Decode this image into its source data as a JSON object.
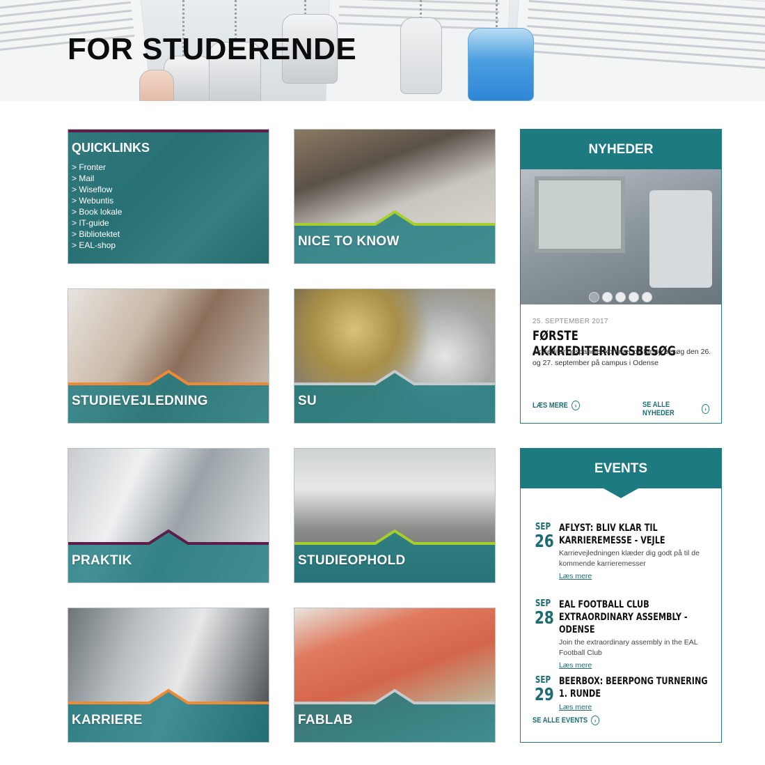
{
  "hero": {
    "title": "FOR STUDERENDE"
  },
  "quicklinks": {
    "title": "QUICKLINKS",
    "links": [
      "> Fronter",
      "> Mail",
      "> Wiseflow",
      "> Webuntis",
      "> Book lokale",
      "> IT-guide",
      "> Bibliotektet",
      "> EAL-shop"
    ]
  },
  "tiles": {
    "nice_to_know": "NICE TO KNOW",
    "studievejledning": "STUDIEVEJLEDNING",
    "su": "SU",
    "praktik": "PRAKTIK",
    "studieophold": "STUDIEOPHOLD",
    "karriere": "KARRIERE",
    "fablab": "FABLAB"
  },
  "accent_colors": {
    "teal": "#1c7a80",
    "lime": "#a7cf2b",
    "orange": "#ee8a36",
    "purple": "#5c1e49",
    "silver": "#c7cacc"
  },
  "news": {
    "heading": "NYHEDER",
    "date": "25. SEPTEMBER 2017",
    "title": "FØRSTE AKKREDITERINGSBESØG",
    "text": "Akkrediteringspanelet kommer på første besøg den 26. og 27. september på campus i Odense",
    "read_more": "LÆS MERE",
    "see_all": "SE ALLE NYHEDER",
    "slide_count": 5,
    "active_slide": 1
  },
  "events": {
    "heading": "EVENTS",
    "items": [
      {
        "month": "SEP",
        "day": "26",
        "title": "AFLYST: BLIV KLAR TIL KARRIEREMESSE - VEJLE",
        "text": "Karrievejledningen klæder dig godt på til de kommende karrieremesser",
        "link": "Læs mere"
      },
      {
        "month": "SEP",
        "day": "28",
        "title": "EAL FOOTBALL CLUB EXTRAORDINARY ASSEMBLY - ODENSE",
        "text": "Join the extraordinary assembly in the EAL Football Club",
        "link": "Læs mere"
      },
      {
        "month": "SEP",
        "day": "29",
        "title": "BEERBOX: BEERPONG TURNERING 1. RUNDE",
        "text": "",
        "link": "Læs mere"
      }
    ],
    "see_all": "SE ALLE EVENTS"
  }
}
